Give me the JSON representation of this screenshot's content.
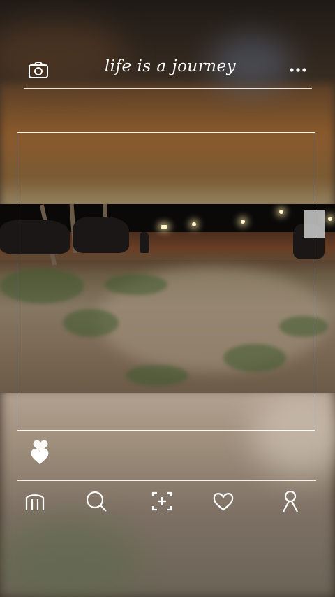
{
  "header": {
    "title": "life is a journey",
    "camera_icon": "camera-icon",
    "more_icon": "more-dots-icon"
  },
  "post": {
    "photo_icon": "photo",
    "like_icon": "hearts-icon"
  },
  "nav": {
    "items": [
      {
        "icon": "home-icon"
      },
      {
        "icon": "search-icon"
      },
      {
        "icon": "add-post-icon"
      },
      {
        "icon": "heart-icon"
      },
      {
        "icon": "profile-icon"
      }
    ]
  },
  "colors": {
    "ui_line": "#ffffff",
    "icon": "#ffffff"
  }
}
